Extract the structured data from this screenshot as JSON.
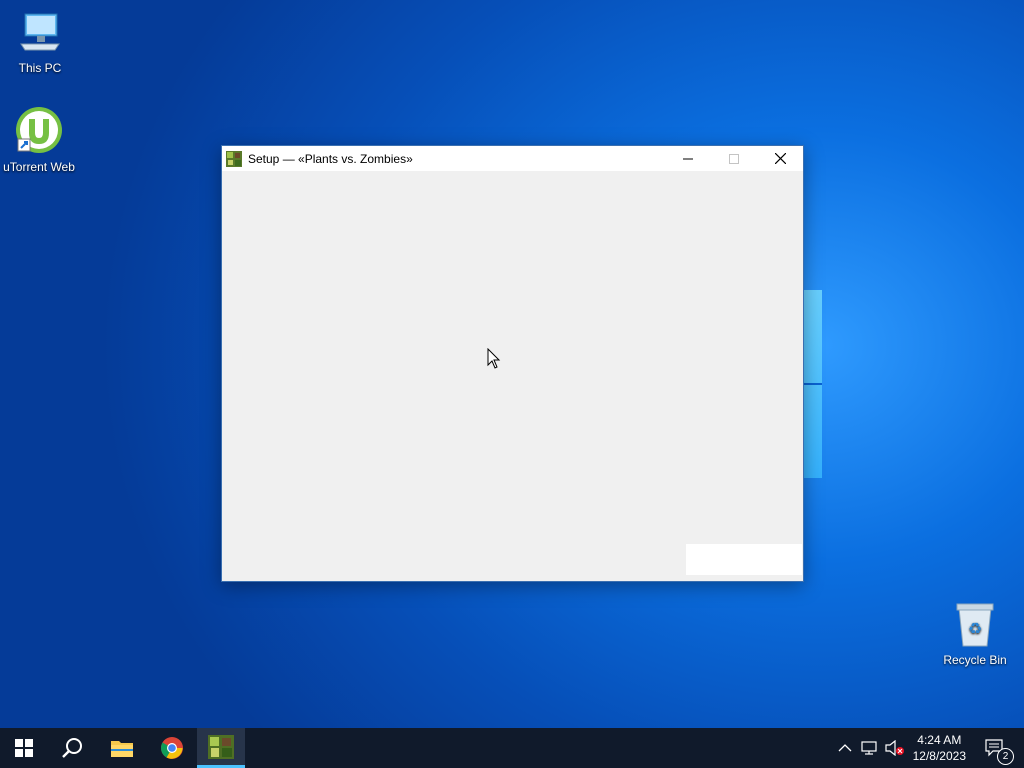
{
  "desktop": {
    "icons": [
      {
        "label": "This PC"
      },
      {
        "label": "uTorrent Web"
      },
      {
        "label": "Recycle Bin"
      }
    ]
  },
  "window": {
    "title": "Setup — «Plants vs. Zombies»",
    "controls": {
      "minimize": "minimize",
      "maximize": "maximize",
      "close": "close"
    }
  },
  "taskbar": {
    "time": "4:24 AM",
    "date": "12/8/2023",
    "notification_count": "2"
  },
  "colors": {
    "accent": "#4cc2ff",
    "taskbar": "#101a2b",
    "window_bg": "#f0f0f0"
  }
}
